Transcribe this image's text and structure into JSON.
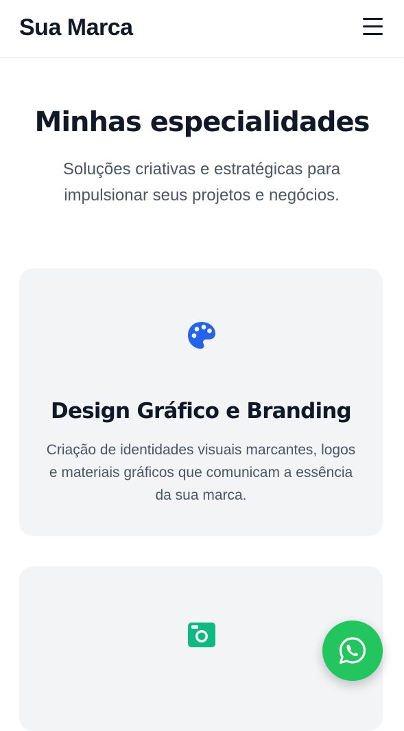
{
  "header": {
    "brand": "Sua Marca",
    "menu_icon": "hamburger-menu-icon"
  },
  "section": {
    "title": "Minhas especialidades",
    "subtitle": "Soluções criativas e estratégicas para impulsionar seus projetos e negócios."
  },
  "cards": [
    {
      "icon": "palette-icon",
      "icon_color": "#2563eb",
      "title": "Design Gráfico e Branding",
      "description": "Criação de identidades visuais marcantes, logos e materiais gráficos que comunicam a essência da sua marca."
    },
    {
      "icon": "camera-icon",
      "icon_color": "#10b981"
    }
  ],
  "floating": {
    "icon": "whatsapp-icon",
    "color": "#22c55e"
  }
}
